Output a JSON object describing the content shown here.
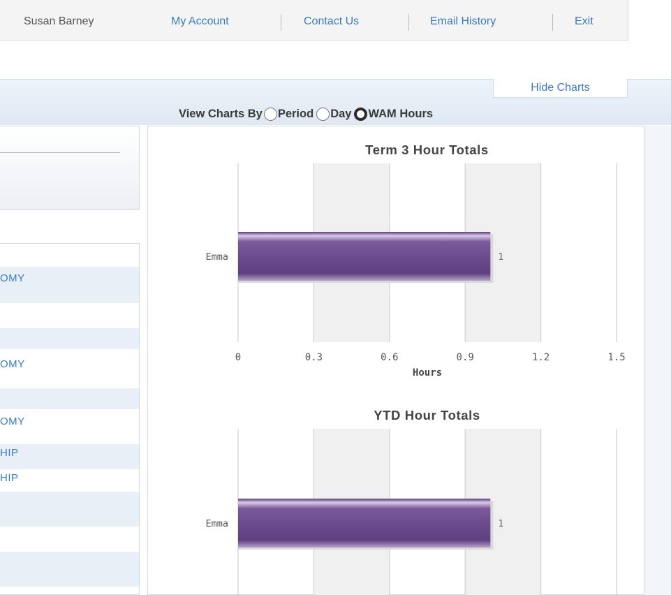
{
  "nav": {
    "user": "Susan Barney",
    "links": [
      "My Account",
      "Contact Us",
      "Email History",
      "Exit"
    ]
  },
  "charts_panel": {
    "hide_label": "Hide Charts",
    "view_by_label": "View Charts By",
    "options": [
      {
        "label": "Period",
        "selected": false
      },
      {
        "label": "Day",
        "selected": false
      },
      {
        "label": "WAM Hours",
        "selected": true
      }
    ]
  },
  "left_list": {
    "rows": [
      "OMY",
      "OMY",
      "OMY",
      "HIP",
      "HIP"
    ]
  },
  "colors": {
    "link": "#3a7bbf",
    "bar": "#6f4f8f",
    "bar_highlight": "#c9b5da"
  },
  "chart_data": [
    {
      "type": "bar",
      "orientation": "horizontal",
      "title": "Term 3 Hour Totals",
      "categories": [
        "Emma"
      ],
      "values": [
        1
      ],
      "data_labels": [
        "1"
      ],
      "xlabel": "Hours",
      "xlim": [
        0,
        1.5
      ],
      "xticks": [
        "0",
        "0.3",
        "0.6",
        "0.9",
        "1.2",
        "1.5"
      ],
      "alternating_bands": true
    },
    {
      "type": "bar",
      "orientation": "horizontal",
      "title": "YTD Hour Totals",
      "categories": [
        "Emma"
      ],
      "values": [
        1
      ],
      "data_labels": [
        "1"
      ],
      "xlim": [
        0,
        1.5
      ],
      "alternating_bands": true
    }
  ]
}
